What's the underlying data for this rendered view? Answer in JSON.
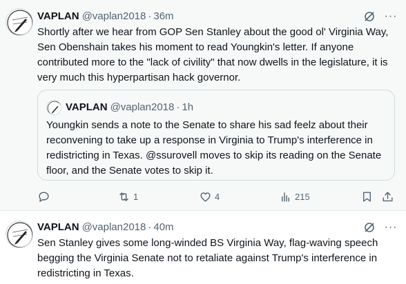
{
  "posts": [
    {
      "author": {
        "display_name": "VAPLAN",
        "handle": "@vaplan2018",
        "time": "36m"
      },
      "text": "Shortly after we hear from GOP Sen Stanley about the good ol' Virginia Way, Sen Obenshain takes his moment to read Youngkin's letter. If anyone contributed more to the \"lack of civility\" that now dwells in the legislature, it is very much this hyperpartisan hack governor.",
      "quote": {
        "author": {
          "display_name": "VAPLAN",
          "handle": "@vaplan2018",
          "time": "1h"
        },
        "text": "Youngkin sends a note to the Senate to share his sad feelz about their reconvening to take up a response in Virginia to Trump's interference in redistricting in Texas. @ssurovell moves to skip its reading on the Senate floor, and the Senate votes to skip it."
      },
      "actions": {
        "reply_count": "",
        "repost_count": "1",
        "like_count": "4",
        "views_count": "215"
      }
    },
    {
      "author": {
        "display_name": "VAPLAN",
        "handle": "@vaplan2018",
        "time": "40m"
      },
      "text": "Sen Stanley gives some long-winded BS Virginia Way, flag-waving speech begging the Virginia Senate not to retaliate against Trump's interference in redistricting in Texas."
    }
  ],
  "separator": "·",
  "more_glyph": "···",
  "icons": [
    "grok-icon",
    "more-icon",
    "reply-icon",
    "repost-icon",
    "like-icon",
    "views-icon",
    "bookmark-icon",
    "share-icon"
  ],
  "colors": {
    "text": "#0f1419",
    "secondary": "#536471",
    "border": "#cfd9de",
    "hover_bg": "#f7f9f9"
  }
}
